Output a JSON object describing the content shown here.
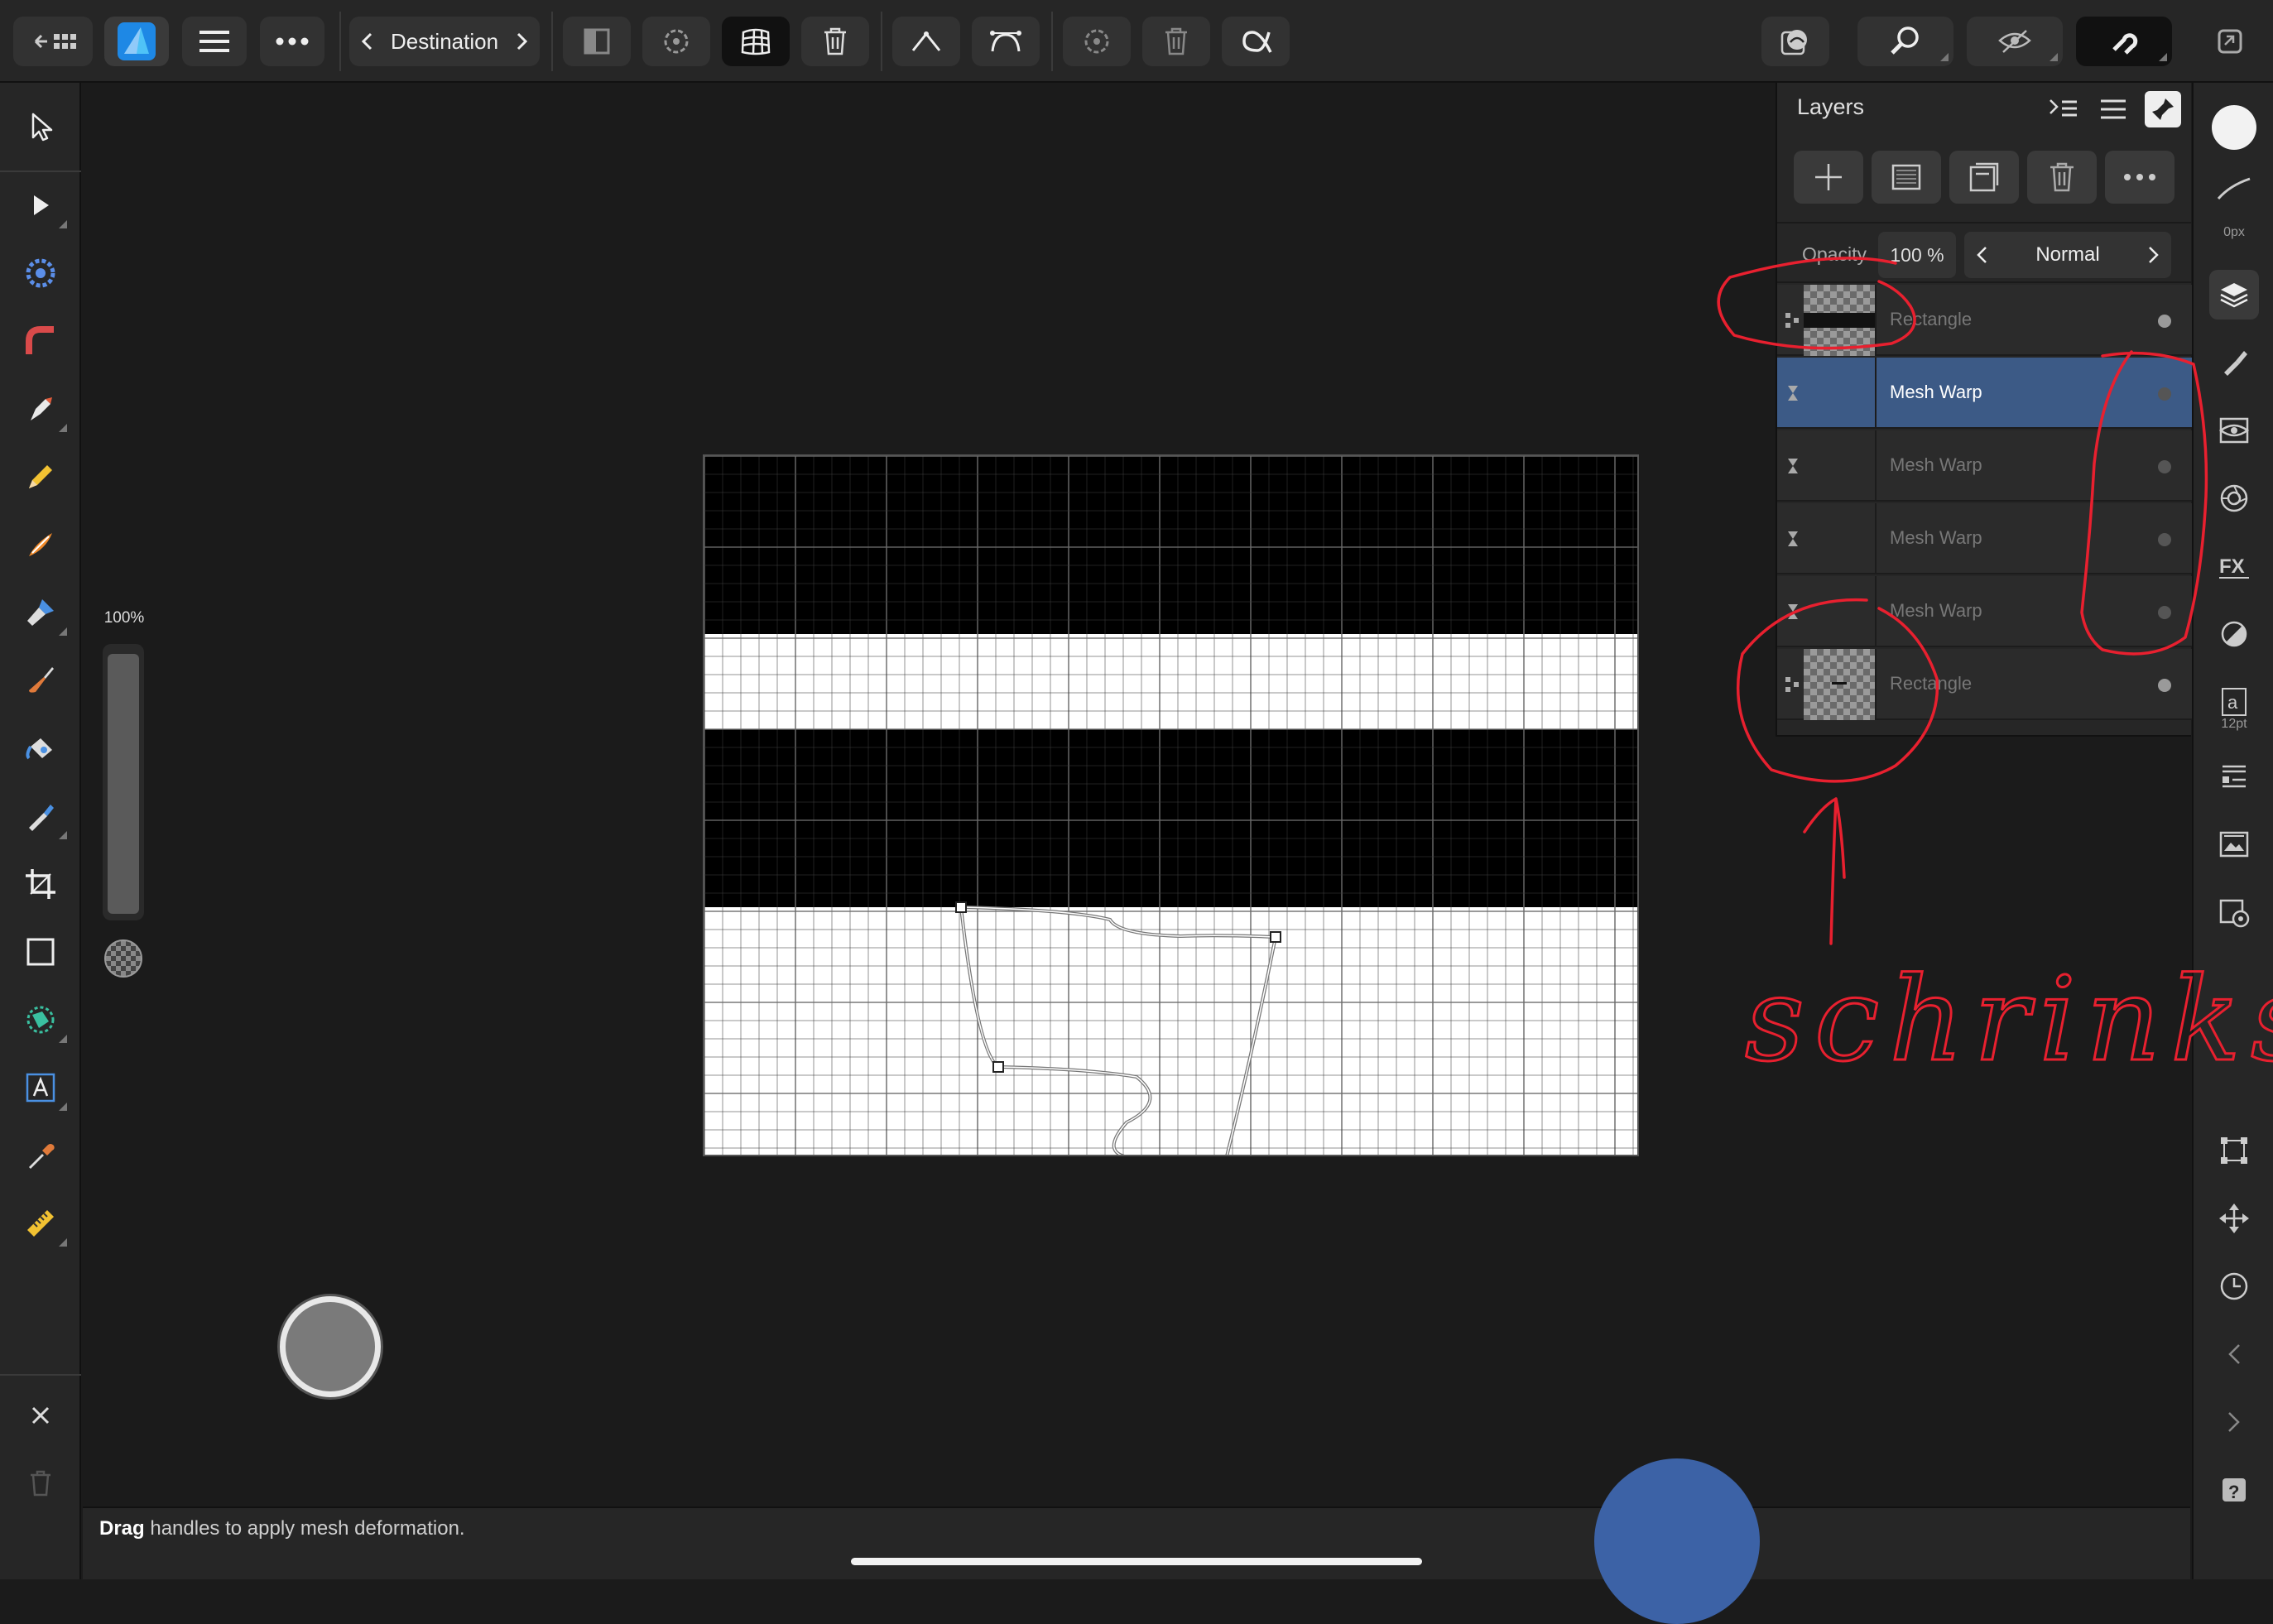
{
  "toolbar": {
    "destination_label": "Destination",
    "buttons": [
      "back-to-gallery",
      "affinity-logo",
      "menu",
      "more",
      "view-mode",
      "transform",
      "mesh",
      "delete",
      "convert-sharp",
      "convert-smooth",
      "reset",
      "delete-node",
      "alpha"
    ]
  },
  "left_tools": [
    "move",
    "node",
    "view",
    "corner",
    "pen",
    "pencil",
    "vector-brush",
    "fill",
    "paint-brush",
    "flood-fill",
    "paint-mixer",
    "crop",
    "rectangle",
    "selection",
    "text",
    "color-picker",
    "measure"
  ],
  "opacity_slider": {
    "label": "100%",
    "value": 1.0
  },
  "layers": {
    "title": "Layers",
    "opacity_label": "Opacity",
    "opacity_value": "100 %",
    "blend_mode": "Normal",
    "rows": [
      {
        "name": "Rectangle",
        "type": "rectangle",
        "active": false,
        "visible": true
      },
      {
        "name": "Mesh Warp",
        "type": "mesh-warp",
        "active": true,
        "visible": false
      },
      {
        "name": "Mesh Warp",
        "type": "mesh-warp",
        "active": false,
        "visible": false
      },
      {
        "name": "Mesh Warp",
        "type": "mesh-warp",
        "active": false,
        "visible": false
      },
      {
        "name": "Mesh Warp",
        "type": "mesh-warp",
        "active": false,
        "visible": false
      },
      {
        "name": "Rectangle",
        "type": "rectangle",
        "active": false,
        "visible": true
      }
    ]
  },
  "right_bar": {
    "stroke_width": "0px",
    "text_size": "12pt",
    "studios": [
      "color",
      "stroke",
      "layers",
      "brushes",
      "adjustments",
      "channels",
      "fx",
      "styles",
      "text-styles",
      "swatches",
      "navigator",
      "history",
      "snapping",
      "transform",
      "history-clock",
      "collapse",
      "expand",
      "help"
    ]
  },
  "status": {
    "bold": "Drag",
    "rest": " handles to apply mesh deformation."
  },
  "annotation": {
    "text": "schrinks",
    "color": "#e8202f"
  },
  "colors": {
    "accent": "#3c5a86",
    "touch_indicator": "#3c62a6",
    "brand": "#1e88e5"
  }
}
